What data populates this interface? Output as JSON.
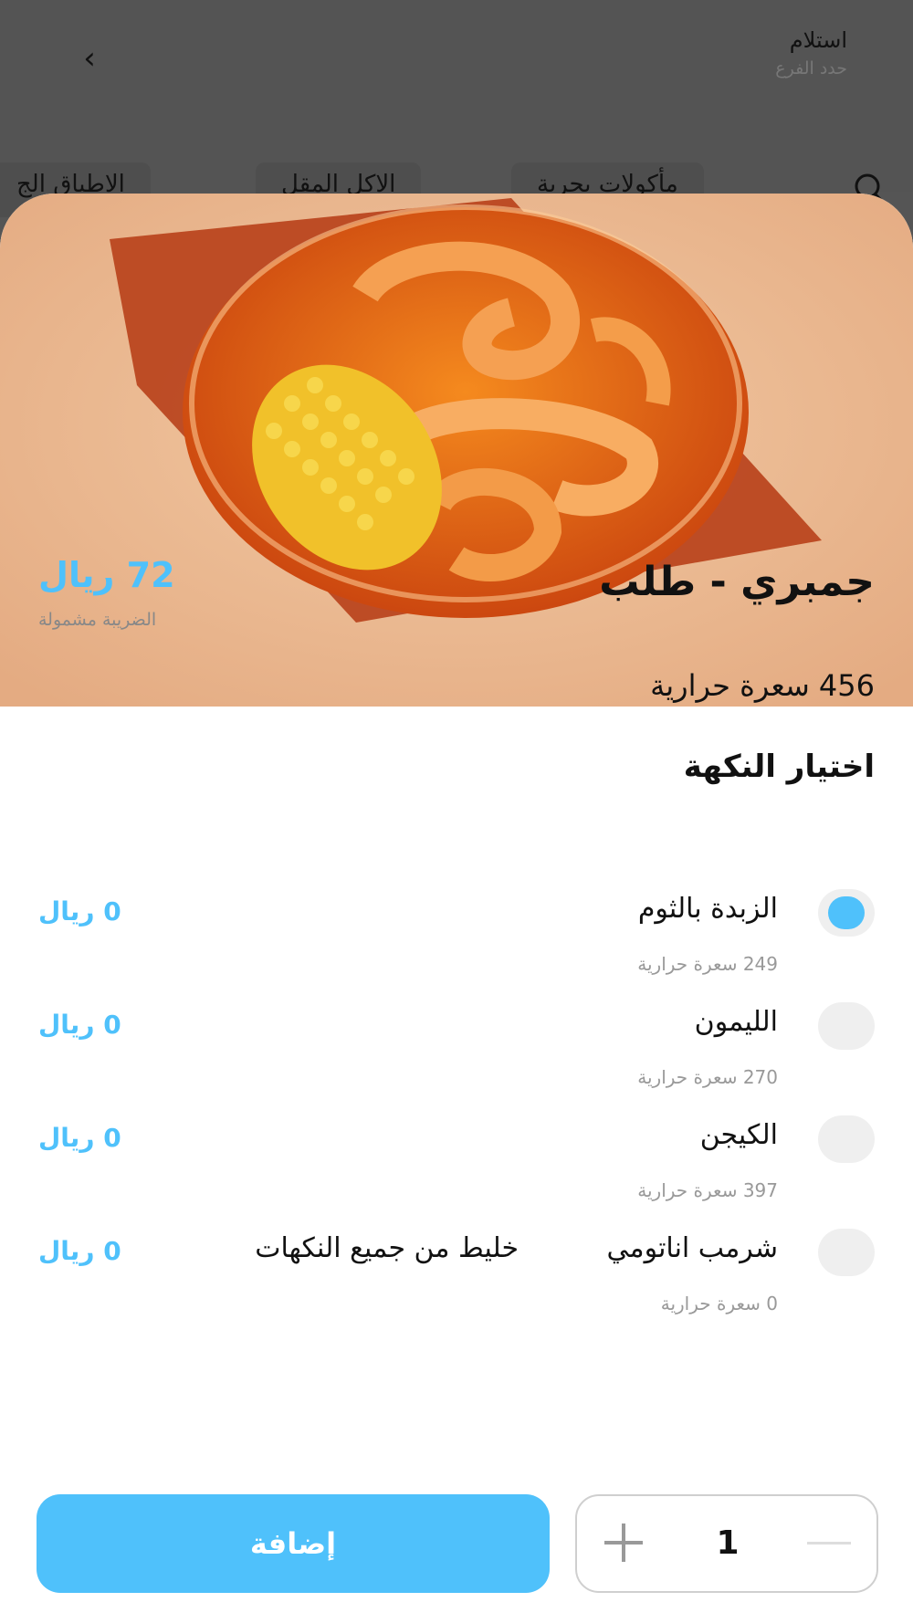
{
  "header": {
    "pickup_label": "استلام",
    "branch_label": "حدد الفرع",
    "back_icon": "chevron-left-icon"
  },
  "categories": [
    "الاطباق الج",
    "الاكل المقل",
    "مأكولات بحرية"
  ],
  "product": {
    "title": "جمبري - طلب",
    "price": "72 ريال",
    "tax_note": "الضريبة مشمولة",
    "calories": "456 سعرة حرارية",
    "section_title": "اختيار النكهة"
  },
  "options": [
    {
      "name": "الزبدة بالثوم",
      "description": "",
      "price": "0 ريال",
      "calories": "249 سعرة حرارية",
      "selected": true
    },
    {
      "name": "الليمون",
      "description": "",
      "price": "0 ريال",
      "calories": "270 سعرة حرارية",
      "selected": false
    },
    {
      "name": "الكيجن",
      "description": "",
      "price": "0 ريال",
      "calories": "397 سعرة حرارية",
      "selected": false
    },
    {
      "name": "شرمب اناتومي",
      "description": "خليط من جميع النكهات",
      "price": "0 ريال",
      "calories": "0 سعرة حرارية",
      "selected": false
    }
  ],
  "footer": {
    "add_label": "إضافة",
    "quantity": "1"
  },
  "colors": {
    "accent": "#4fc1fb",
    "overlay": "#545454"
  }
}
